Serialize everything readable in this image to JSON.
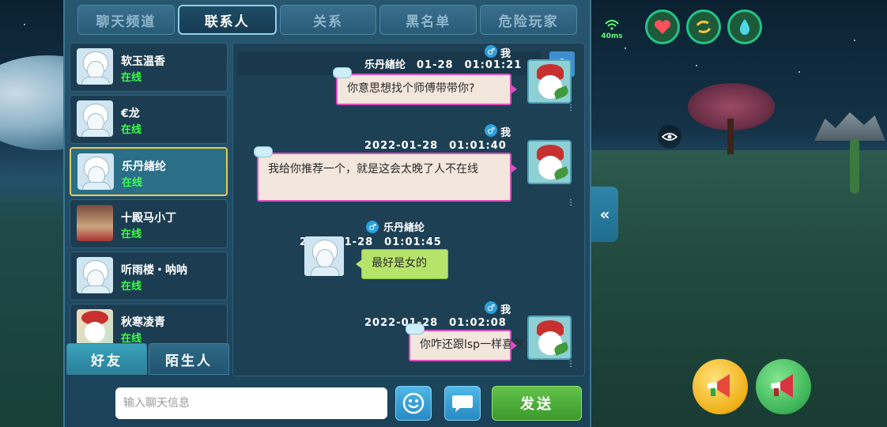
{
  "tabs": [
    {
      "label": "聊天频道",
      "active": false
    },
    {
      "label": "联系人",
      "active": true
    },
    {
      "label": "关系",
      "active": false
    },
    {
      "label": "黑名单",
      "active": false
    },
    {
      "label": "危险玩家",
      "active": false
    }
  ],
  "contacts": [
    {
      "name": "软玉温香",
      "status": "在线",
      "avatar": "white-hair-avatar"
    },
    {
      "name": "€龙",
      "status": "在线",
      "avatar": "white-hair-avatar"
    },
    {
      "name": "乐丹緖纶",
      "status": "在线",
      "avatar": "white-hair-avatar",
      "selected": true
    },
    {
      "name": "十殿马小丁",
      "status": "在线",
      "avatar": "male-avatar"
    },
    {
      "name": "听雨楼・呐呐",
      "status": "在线",
      "avatar": "white-hair-avatar"
    },
    {
      "name": "秋寒凌青",
      "status": "在线",
      "avatar": "snowman-avatar"
    }
  ],
  "friend_tabs": {
    "friends": "好友",
    "strangers": "陌生人"
  },
  "chat": {
    "header_name": "乐丹緖纶",
    "header_time": "01-28　01:01:21",
    "messages": [
      {
        "from": "me",
        "name": "我",
        "time": "",
        "text": "你意思想找个师傅带带你?"
      },
      {
        "from": "me",
        "name": "我",
        "time": "2022-01-28　01:01:40",
        "text": "我给你推荐一个，就是这会太晚了人不在线"
      },
      {
        "from": "other",
        "name": "乐丹緖纶",
        "time": "2022-01-28　01:01:45",
        "text": "最好是女的"
      },
      {
        "from": "me",
        "name": "我",
        "time": "2022-01-28　01:02:08",
        "text": "你咋还跟lsp一样喜欢女的"
      }
    ]
  },
  "input": {
    "placeholder": "输入聊天信息",
    "value": ""
  },
  "send_label": "发送",
  "hud": {
    "ping": "40ms",
    "icons": [
      "heart-icon",
      "swap-icon",
      "water-drop-icon"
    ]
  },
  "colors": {
    "accent": "#8fd1ea",
    "online": "#3cff4a",
    "send": "#4fae3a",
    "my_bubble_border": "#e04cc2",
    "their_bubble": "#b6e36a"
  }
}
